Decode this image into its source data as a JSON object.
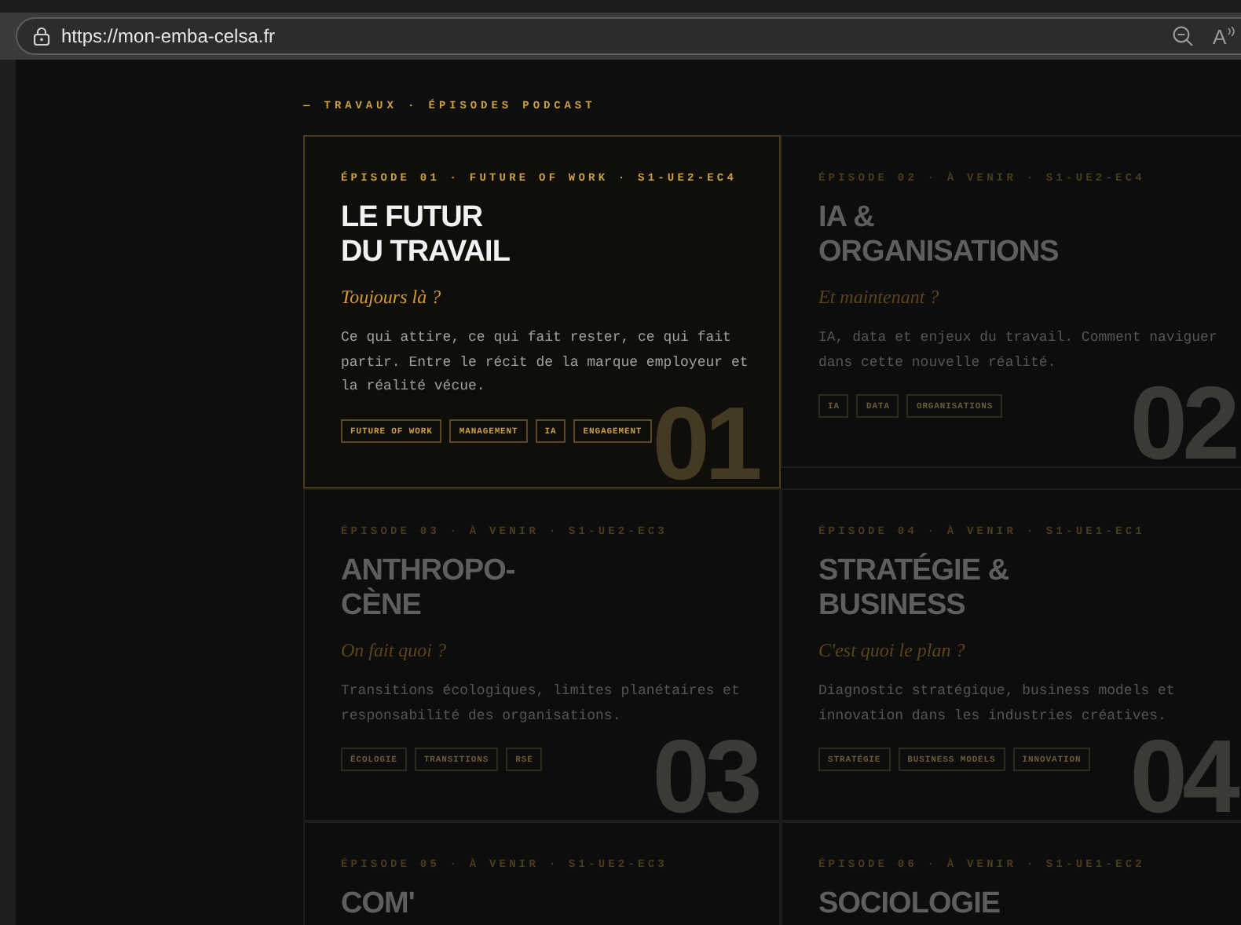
{
  "browser": {
    "url": "https://mon-emba-celsa.fr",
    "read_aloud_label": "A"
  },
  "section_label": "— TRAVAUX · ÉPISODES PODCAST",
  "episodes": [
    {
      "active": true,
      "meta": "ÉPISODE 01 · FUTURE OF WORK · S1-UE2-EC4",
      "title": [
        "LE FUTUR",
        "DU TRAVAIL"
      ],
      "subtitle": "Toujours là ?",
      "description": "Ce qui attire, ce qui fait rester, ce qui fait partir. Entre le récit de la marque employeur et la réalité vécue.",
      "tags": [
        "FUTURE OF WORK",
        "MANAGEMENT",
        "IA",
        "ENGAGEMENT"
      ],
      "number": "01"
    },
    {
      "active": false,
      "meta": "ÉPISODE 02 · À VENIR · S1-UE2-EC4",
      "title": [
        "IA &",
        "ORGANISATIONS"
      ],
      "subtitle": "Et maintenant ?",
      "description": "IA, data et enjeux du travail. Comment naviguer dans cette nouvelle réalité.",
      "tags": [
        "IA",
        "DATA",
        "ORGANISATIONS"
      ],
      "number": "02"
    },
    {
      "active": false,
      "meta": "ÉPISODE 03 · À VENIR · S1-UE2-EC3",
      "title": [
        "ANTHROPO-",
        "CÈNE"
      ],
      "subtitle": "On fait quoi ?",
      "description": "Transitions écologiques, limites planétaires et responsabilité des organisations.",
      "tags": [
        "ÉCOLOGIE",
        "TRANSITIONS",
        "RSE"
      ],
      "number": "03"
    },
    {
      "active": false,
      "meta": "ÉPISODE 04 · À VENIR · S1-UE1-EC1",
      "title": [
        "STRATÉGIE &",
        "BUSINESS"
      ],
      "subtitle": "C'est quoi le plan ?",
      "description": "Diagnostic stratégique, business models et innovation dans les industries créatives.",
      "tags": [
        "STRATÉGIE",
        "BUSINESS MODELS",
        "INNOVATION"
      ],
      "number": "04"
    },
    {
      "active": false,
      "meta": "ÉPISODE 05 · À VENIR · S1-UE2-EC3",
      "title": [
        "COM'"
      ]
    },
    {
      "active": false,
      "meta": "ÉPISODE 06 · À VENIR · S1-UE1-EC2",
      "title": [
        "SOCIOLOGIE"
      ]
    }
  ]
}
